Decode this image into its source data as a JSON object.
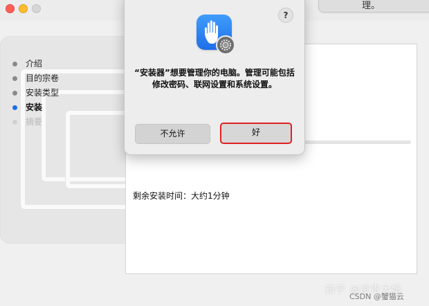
{
  "window": {
    "top_right_label": "理。"
  },
  "sidebar": {
    "steps": [
      {
        "label": "介绍",
        "state": "done"
      },
      {
        "label": "目的宗卷",
        "state": "done"
      },
      {
        "label": "安装类型",
        "state": "done"
      },
      {
        "label": "安装",
        "state": "active"
      },
      {
        "label": "摘要",
        "state": "pending"
      }
    ]
  },
  "content": {
    "remaining_time": "剩余安装时间：大约1分钟"
  },
  "dialog": {
    "help_label": "?",
    "icon": "hand-stop-icon",
    "badge_icon": "gear-icon",
    "message": "“安装器”想要管理你的电脑。管理可能包括修改密码、联网设置和系统设置。",
    "deny_label": "不允许",
    "ok_label": "好"
  },
  "watermark": {
    "line1": "知乎 @凌贵大妈",
    "line2": "CSDN @蟹猫云"
  },
  "colors": {
    "accent": "#1f6fe5",
    "highlight_border": "#e02020"
  }
}
